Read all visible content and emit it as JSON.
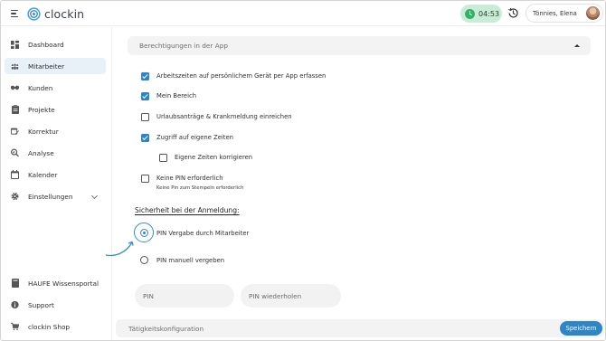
{
  "header": {
    "brand": "clockin",
    "timer": "04:53",
    "user_name": "Tönnies, Elena"
  },
  "sidebar": {
    "items": [
      {
        "label": "Dashboard",
        "icon": "dashboard-icon"
      },
      {
        "label": "Mitarbeiter",
        "icon": "users-icon",
        "active": true
      },
      {
        "label": "Kunden",
        "icon": "handshake-icon"
      },
      {
        "label": "Projekte",
        "icon": "clipboard-icon"
      },
      {
        "label": "Korrektur",
        "icon": "calendar-edit-icon"
      },
      {
        "label": "Analyse",
        "icon": "magnifier-chart-icon"
      },
      {
        "label": "Kalender",
        "icon": "calendar-icon"
      },
      {
        "label": "Einstellungen",
        "icon": "gear-icon"
      }
    ],
    "bottom_items": [
      {
        "label": "HAUFE Wissensportal",
        "icon": "book-icon"
      },
      {
        "label": "Support",
        "icon": "info-icon"
      },
      {
        "label": "clockin Shop",
        "icon": "cart-icon"
      }
    ]
  },
  "main": {
    "section_title": "Berechtigungen in der App",
    "checkboxes": [
      {
        "label": "Arbeitszeiten auf persönlichem Gerät per App erfassen",
        "checked": true
      },
      {
        "label": "Mein Bereich",
        "checked": true
      },
      {
        "label": "Urlaubsanträge & Krankmeldung einreichen",
        "checked": false
      },
      {
        "label": "Zugriff auf eigene Zeiten",
        "checked": true
      },
      {
        "label": "Eigene Zeiten korrigieren",
        "checked": false
      },
      {
        "label": "Keine PIN erforderlich",
        "sublabel": "Keine Pin zum Stempeln erforderlich",
        "checked": false
      }
    ],
    "security_heading": "Sicherheit bei der Anmeldung:",
    "radios": [
      {
        "label": "PIN Vergabe durch Mitarbeiter",
        "selected": true
      },
      {
        "label": "PIN manuell vergeben",
        "selected": false
      }
    ],
    "pin_placeholder": "PIN",
    "pin_repeat_placeholder": "PIN wiederholen",
    "next_section_title": "Tätigkeitskonfiguration",
    "save_label": "Speichern"
  },
  "colors": {
    "accent": "#2c86c6",
    "timer_bg": "#c9ecd6",
    "timer_dot": "#2fb464",
    "active_nav_bg": "#e8f0f8"
  }
}
